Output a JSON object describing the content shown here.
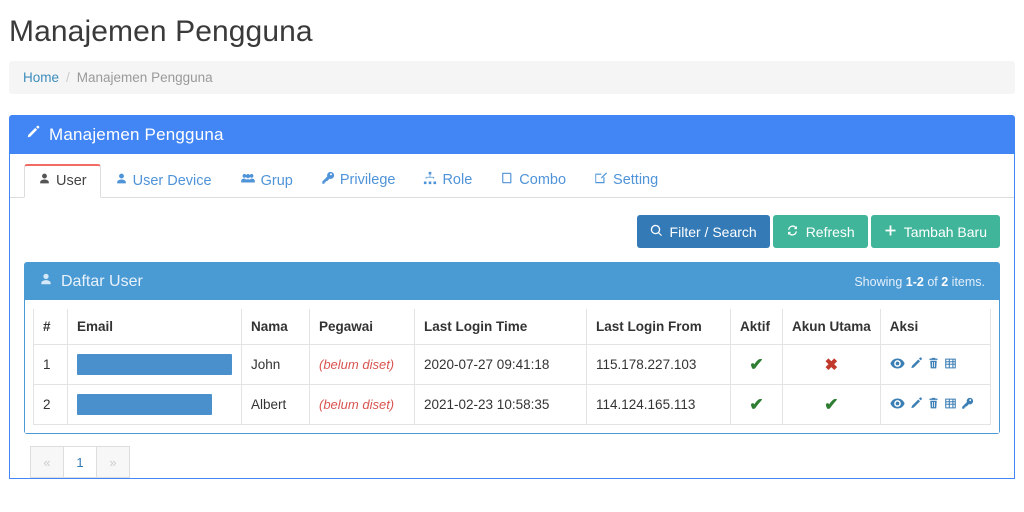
{
  "page": {
    "title": "Manajemen Pengguna"
  },
  "breadcrumb": {
    "home": "Home",
    "separator": "/",
    "current": "Manajemen Pengguna"
  },
  "panel": {
    "title": "Manajemen Pengguna",
    "icon": "pencil-icon"
  },
  "tabs": [
    {
      "label": "User",
      "icon": "user-icon",
      "active": true
    },
    {
      "label": "User Device",
      "icon": "user-icon",
      "active": false
    },
    {
      "label": "Grup",
      "icon": "users-icon",
      "active": false
    },
    {
      "label": "Privilege",
      "icon": "key-icon",
      "active": false
    },
    {
      "label": "Role",
      "icon": "sitemap-icon",
      "active": false
    },
    {
      "label": "Combo",
      "icon": "book-icon",
      "active": false
    },
    {
      "label": "Setting",
      "icon": "edit-icon",
      "active": false
    }
  ],
  "toolbar": {
    "filter_label": "Filter / Search",
    "refresh_label": "Refresh",
    "add_label": "Tambah Baru"
  },
  "table_panel": {
    "title": "Daftar User",
    "icon": "user-icon",
    "summary_prefix": "Showing ",
    "summary_range": "1-2",
    "summary_mid": " of ",
    "summary_total": "2",
    "summary_suffix": " items."
  },
  "table": {
    "columns": [
      "#",
      "Email",
      "Nama",
      "Pegawai",
      "Last Login Time",
      "Last Login From",
      "Aktif",
      "Akun Utama",
      "Aksi"
    ],
    "rows": [
      {
        "num": "1",
        "email": "",
        "email_redacted": true,
        "email_redaction_width": 155,
        "nama": "John",
        "pegawai": "(belum diset)",
        "last_login_time": "2020-07-27 09:41:18",
        "last_login_from": "115.178.227.103",
        "aktif": "✔",
        "aktif_state": "yes",
        "akun_utama": "✖",
        "akun_utama_state": "no",
        "aksi_icons": [
          "view-icon",
          "edit-icon",
          "delete-icon",
          "table-icon"
        ]
      },
      {
        "num": "2",
        "email": "",
        "email_redacted": true,
        "email_redaction_width": 135,
        "nama": "Albert",
        "pegawai": "(belum diset)",
        "last_login_time": "2021-02-23 10:58:35",
        "last_login_from": "114.124.165.113",
        "aktif": "✔",
        "aktif_state": "yes",
        "akun_utama": "✔",
        "akun_utama_state": "yes",
        "aksi_icons": [
          "view-icon",
          "edit-icon",
          "delete-icon",
          "table-icon",
          "key-icon"
        ]
      }
    ]
  },
  "pagination": {
    "items": [
      {
        "label": "«",
        "disabled": true
      },
      {
        "label": "1",
        "disabled": false
      },
      {
        "label": "»",
        "disabled": true
      }
    ]
  },
  "colors": {
    "panel_blue": "#4285f4",
    "table_panel_blue": "#4a9ad4",
    "primary_button": "#337ab7",
    "success_button": "#40b59a",
    "active_tab_accent": "#ef6b63",
    "link_blue": "#3c8dbc",
    "redaction": "#4a90cd",
    "ok_green": "#2e7d32",
    "no_red": "#c0392b",
    "muted_red": "#d9534f"
  }
}
